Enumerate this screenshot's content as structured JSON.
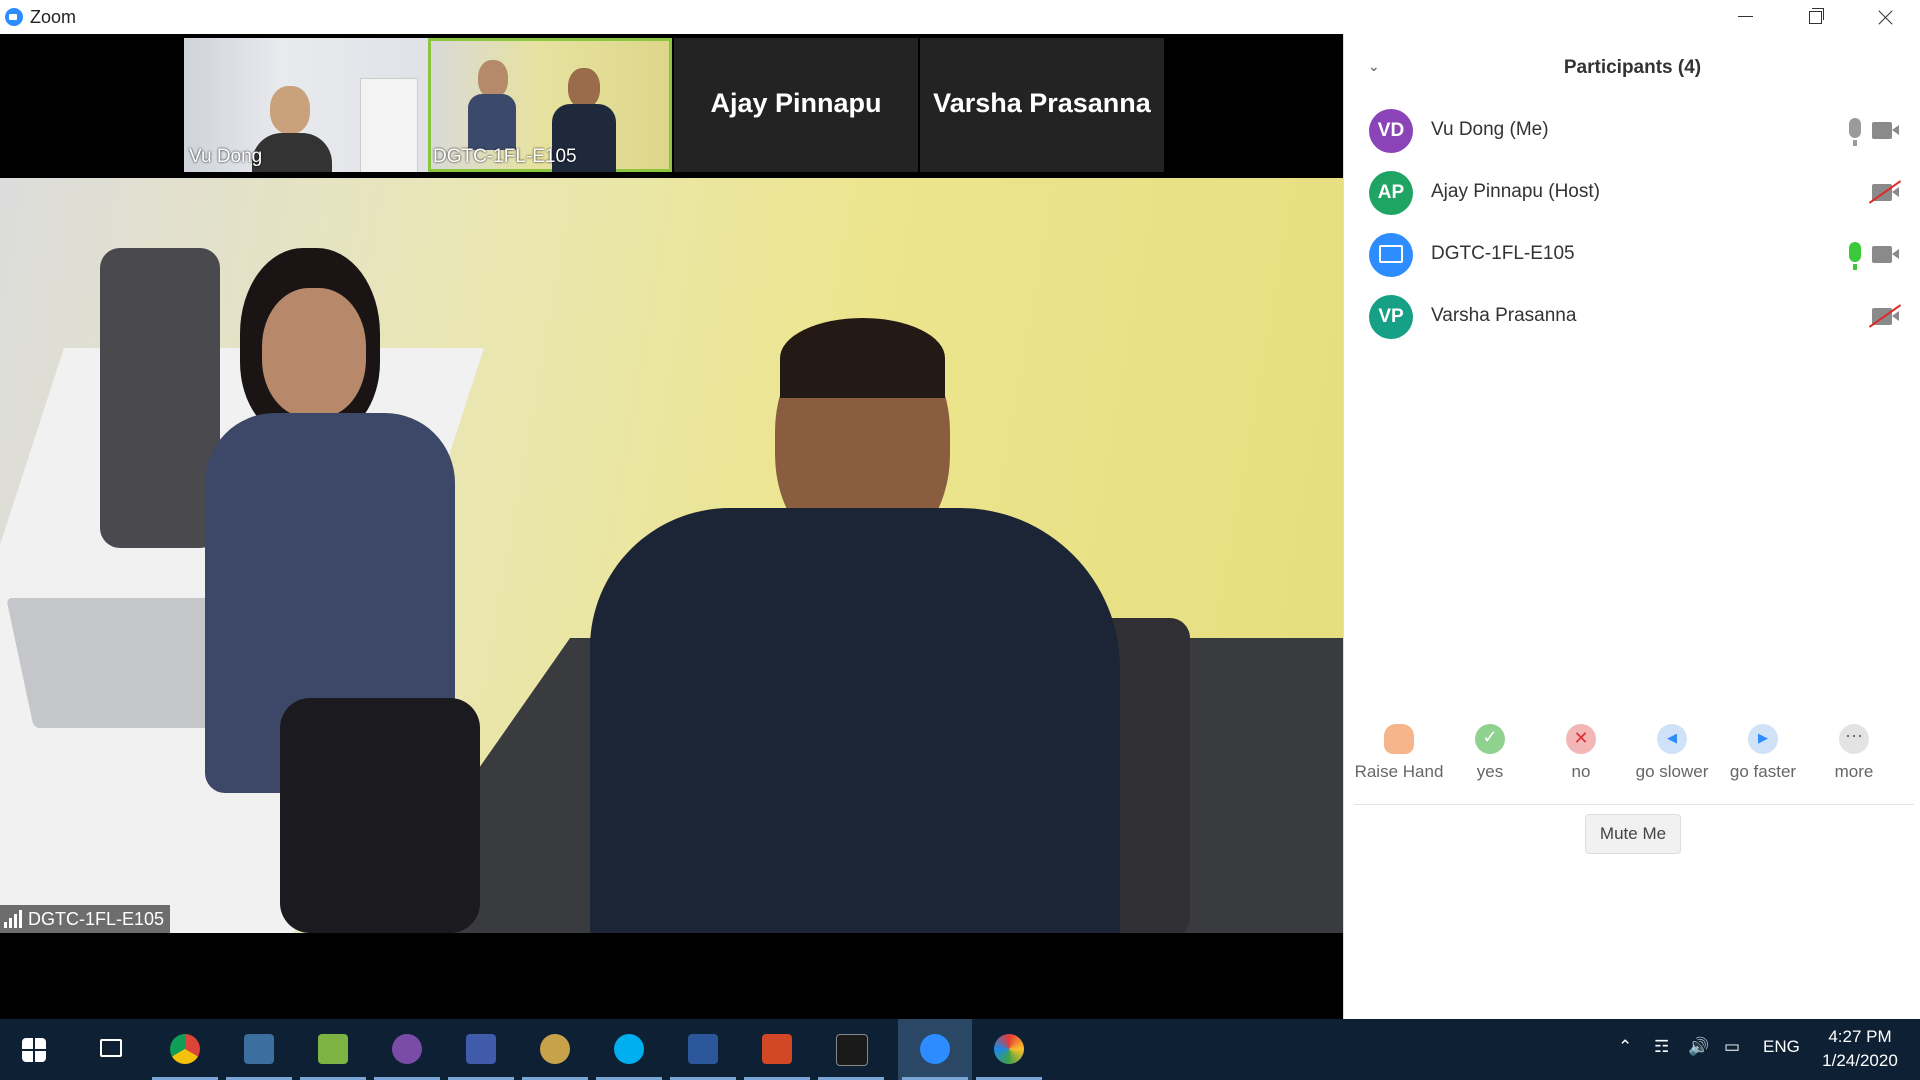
{
  "window": {
    "title": "Zoom"
  },
  "thumbnails": [
    {
      "name": "Vu Dong"
    },
    {
      "name": "DGTC-1FL-E105"
    },
    {
      "name": "Ajay Pinnapu"
    },
    {
      "name": "Varsha Prasanna"
    }
  ],
  "main_video": {
    "name": "DGTC-1FL-E105"
  },
  "participants": {
    "title": "Participants (4)",
    "list": [
      {
        "initials": "VD",
        "name": "Vu Dong (Me)",
        "avatar_color": "#8A44B8"
      },
      {
        "initials": "AP",
        "name": "Ajay Pinnapu (Host)",
        "avatar_color": "#1FA463"
      },
      {
        "initials": "",
        "name": "DGTC-1FL-E105",
        "avatar_color": "#2D8CFF"
      },
      {
        "initials": "VP",
        "name": "Varsha Prasanna",
        "avatar_color": "#16A085"
      }
    ]
  },
  "reactions": [
    {
      "label": "Raise Hand",
      "icon": "raise-hand-icon"
    },
    {
      "label": "yes",
      "icon": "check-icon"
    },
    {
      "label": "no",
      "icon": "x-icon"
    },
    {
      "label": "go slower",
      "icon": "rewind-icon"
    },
    {
      "label": "go faster",
      "icon": "fast-forward-icon"
    },
    {
      "label": "more",
      "icon": "ellipsis-icon"
    }
  ],
  "mute_button": "Mute Me",
  "taskbar": {
    "language": "ENG",
    "time": "4:27 PM",
    "date": "1/24/2020"
  }
}
